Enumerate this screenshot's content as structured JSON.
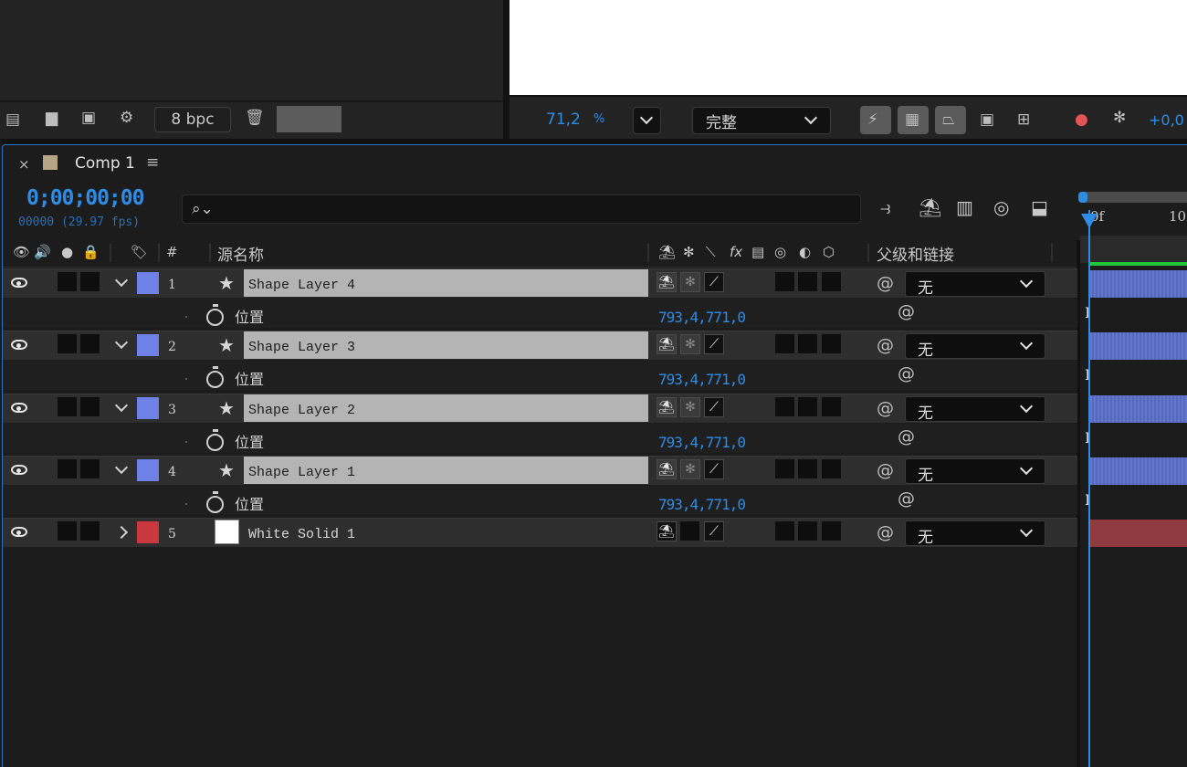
{
  "project_panel": {
    "bpc_label": "8 bpc",
    "icons": [
      "interpret-footage-icon",
      "new-folder-icon",
      "new-composition-icon",
      "project-settings-icon",
      "trash-icon"
    ]
  },
  "viewer": {
    "zoom_value": "71,2",
    "zoom_unit": "%",
    "resolution_label": "完整",
    "exposure_value": "+0,0"
  },
  "timeline": {
    "tab_close": "×",
    "tab_label": "Comp 1",
    "tab_menu": "≡",
    "timecode": "0;00;00;00",
    "frames_fps": "00000 (29.97 fps)",
    "columns": {
      "number": "#",
      "source_name": "源名称",
      "parent_link": "父级和链接"
    },
    "ruler": {
      "start_label": "0f",
      "next_label": "10"
    },
    "layers": [
      {
        "num": "1",
        "name": "Shape Layer 4",
        "label_color": "#6e81e6",
        "parent": "无",
        "prop_name": "位置",
        "prop_value": "793,4,771,0"
      },
      {
        "num": "2",
        "name": "Shape Layer 3",
        "label_color": "#6e81e6",
        "parent": "无",
        "prop_name": "位置",
        "prop_value": "793,4,771,0"
      },
      {
        "num": "3",
        "name": "Shape Layer 2",
        "label_color": "#6e81e6",
        "parent": "无",
        "prop_name": "位置",
        "prop_value": "793,4,771,0"
      },
      {
        "num": "4",
        "name": "Shape Layer 1",
        "label_color": "#6e81e6",
        "parent": "无",
        "prop_name": "位置",
        "prop_value": "793,4,771,0"
      },
      {
        "num": "5",
        "name": "White Solid 1",
        "label_color": "#c9383f",
        "parent": "无"
      }
    ]
  },
  "colors": {
    "accent": "#2e8ce6",
    "shape_bar": "#5a6fc8",
    "solid_bar": "#8f3a3e",
    "cache_green": "#22c53a"
  }
}
